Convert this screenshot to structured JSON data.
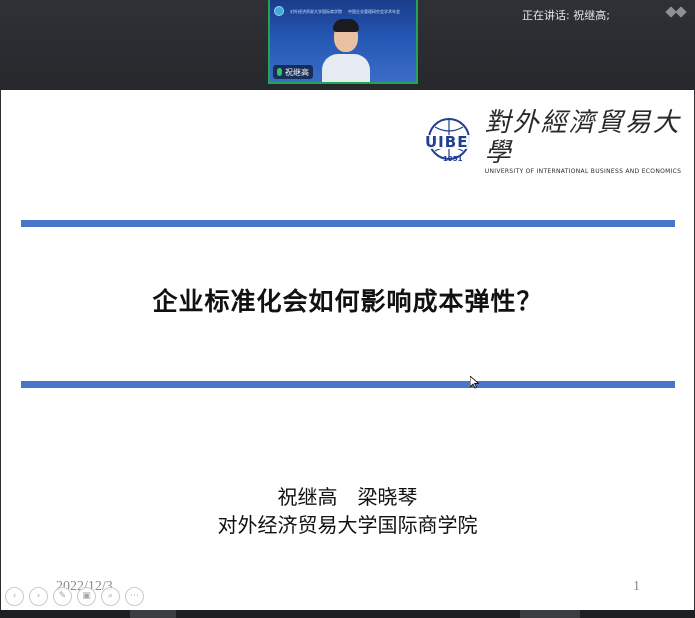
{
  "meeting": {
    "participant_name": "祝继高",
    "speaking_label": "正在讲话: 祝继高;",
    "icons": [
      "microphone-icon",
      "fullscreen-icon"
    ]
  },
  "video_banner": {
    "line1": "对外经济贸易大学国际商学院",
    "line2": "中国企业管理研究会学术年会"
  },
  "slide": {
    "logo": {
      "emblem_text": "UIBE",
      "year": "1951",
      "name_cn": "對外經濟貿易大學",
      "name_en": "UNIVERSITY OF INTERNATIONAL BUSINESS AND ECONOMICS"
    },
    "title": "企业标准化会如何影响成本弹性？",
    "authors": "祝继高　梁晓琴",
    "affiliation": "对外经济贸易大学国际商学院",
    "date": "2022/12/3",
    "page_number": "1",
    "band_color": "#4a76c9"
  },
  "slide_controls": [
    {
      "name": "prev-icon",
      "glyph": "‹"
    },
    {
      "name": "next-icon",
      "glyph": "›"
    },
    {
      "name": "pen-icon",
      "glyph": "✎"
    },
    {
      "name": "slides-icon",
      "glyph": "▣"
    },
    {
      "name": "zoom-icon",
      "glyph": "⌕"
    },
    {
      "name": "more-icon",
      "glyph": "⋯"
    }
  ]
}
